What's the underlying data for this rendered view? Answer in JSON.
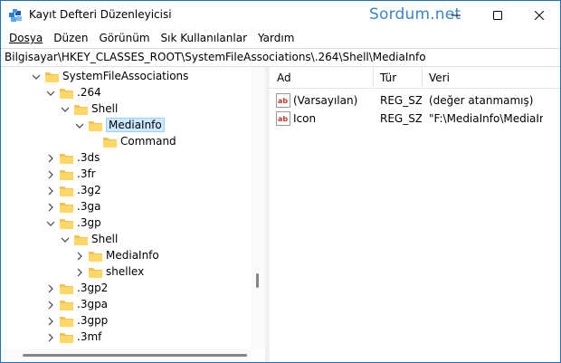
{
  "window": {
    "title": "Kayıt Defteri Düzenleyicisi",
    "watermark": "Sordum.net",
    "accent": "#1f6fc4"
  },
  "menu": [
    "Dosya",
    "Düzen",
    "Görünüm",
    "Sık Kullanılanlar",
    "Yardım"
  ],
  "address": "Bilgisayar\\HKEY_CLASSES_ROOT\\SystemFileAssociations\\.264\\Shell\\MediaInfo",
  "tree": [
    {
      "label": "SystemFileAssociations",
      "chevron": "down",
      "selected": false
    },
    {
      "label": ".264",
      "chevron": "down",
      "selected": false
    },
    {
      "label": "Shell",
      "chevron": "down",
      "selected": false
    },
    {
      "label": "MediaInfo",
      "chevron": "down",
      "selected": true
    },
    {
      "label": "Command",
      "chevron": "none",
      "selected": false
    },
    {
      "label": ".3ds",
      "chevron": "right",
      "selected": false
    },
    {
      "label": ".3fr",
      "chevron": "right",
      "selected": false
    },
    {
      "label": ".3g2",
      "chevron": "right",
      "selected": false
    },
    {
      "label": ".3ga",
      "chevron": "right",
      "selected": false
    },
    {
      "label": ".3gp",
      "chevron": "down",
      "selected": false
    },
    {
      "label": "Shell",
      "chevron": "down",
      "selected": false
    },
    {
      "label": "MediaInfo",
      "chevron": "right",
      "selected": false
    },
    {
      "label": "shellex",
      "chevron": "right",
      "selected": false
    },
    {
      "label": ".3gp2",
      "chevron": "right",
      "selected": false
    },
    {
      "label": ".3gpa",
      "chevron": "right",
      "selected": false
    },
    {
      "label": ".3gpp",
      "chevron": "right",
      "selected": false
    },
    {
      "label": ".3mf",
      "chevron": "right",
      "selected": false
    }
  ],
  "list": {
    "columns": [
      "Ad",
      "Tür",
      "Veri"
    ],
    "rows": [
      {
        "name": "(Varsayılan)",
        "type": "REG_SZ",
        "data": "(değer atanmamış)",
        "icon": "string-value-icon"
      },
      {
        "name": "Icon",
        "type": "REG_SZ",
        "data": "\"F:\\MediaInfo\\MediaInfo",
        "icon": "string-value-icon"
      }
    ]
  }
}
